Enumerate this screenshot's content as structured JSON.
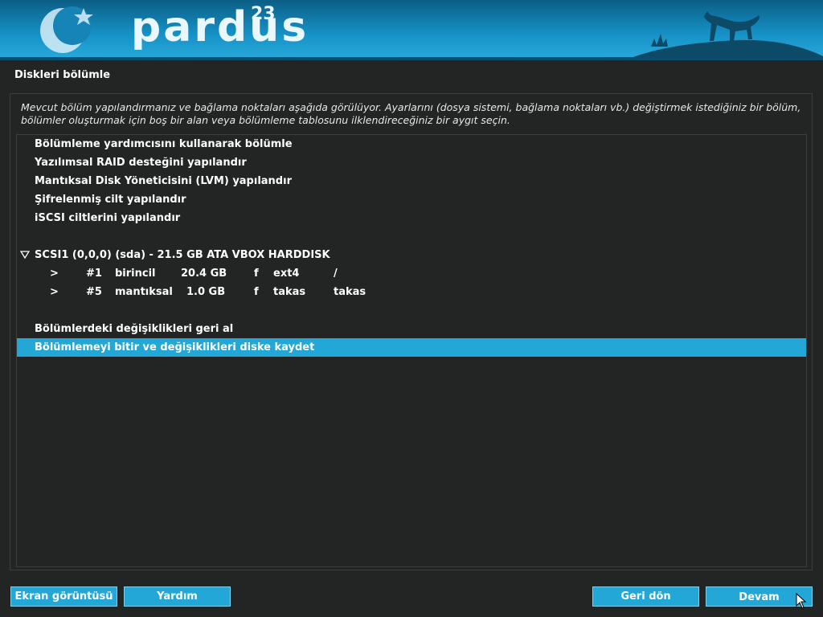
{
  "banner": {
    "logo_text": "pardus",
    "logo_version": "23",
    "colors": {
      "top": "#0b5e86",
      "bottom": "#29abdc"
    }
  },
  "page": {
    "title": "Diskleri bölümle",
    "description": "Mevcut bölüm yapılandırmanız ve bağlama noktaları aşağıda görülüyor. Ayarlarını (dosya sistemi, bağlama noktaları vb.) değiştirmek istediğiniz bir bölüm, bölümler oluşturmak için boş bir alan veya bölümleme tablosunu ilklendireceğiniz bir aygıt seçin."
  },
  "menu": {
    "guided": "Bölümleme yardımcısını kullanarak bölümle",
    "raid": "Yazılımsal RAID desteğini yapılandır",
    "lvm": "Mantıksal Disk Yöneticisini (LVM) yapılandır",
    "encrypted": "Şifrelenmiş cilt yapılandır",
    "iscsi": "iSCSI ciltlerini yapılandır"
  },
  "disk": {
    "label": "SCSI1 (0,0,0) (sda) - 21.5 GB ATA VBOX HARDDISK",
    "partitions": [
      {
        "arrow": ">",
        "num": "#1",
        "type": "birincil",
        "size": "20.4 GB",
        "flag": "f",
        "fs": "ext4",
        "mount": "/"
      },
      {
        "arrow": ">",
        "num": "#5",
        "type": "mantıksal",
        "size": "1.0 GB",
        "flag": "f",
        "fs": "takas",
        "mount": "takas"
      }
    ]
  },
  "actions": {
    "undo": "Bölümlerdeki değişiklikleri geri al",
    "finish": "Bölümlemeyi bitir ve değişiklikleri diske kaydet"
  },
  "buttons": {
    "screenshot": "Ekran görüntüsü",
    "help": "Yardım",
    "back": "Geri dön",
    "continue": "Devam"
  },
  "colors": {
    "accent": "#22a7d6",
    "background": "#222523"
  }
}
